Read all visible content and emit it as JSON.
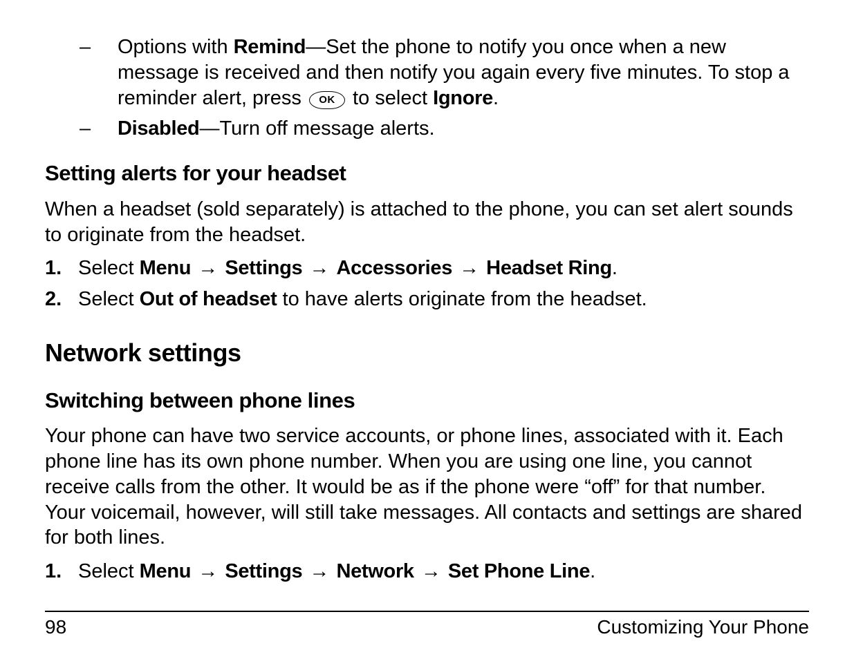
{
  "bullets": {
    "remind": {
      "label": "Remind",
      "prefix": "Options with ",
      "divider": "—",
      "text1": "Set the phone to notify you once when a new message is received and then notify you again every five minutes. To stop a reminder alert, press ",
      "ok": "OK",
      "text2": " to select ",
      "ignore": "Ignore",
      "period": "."
    },
    "disabled": {
      "label": "Disabled",
      "divider": "—",
      "text": "Turn off message alerts."
    }
  },
  "headset": {
    "heading": "Setting alerts for your headset",
    "intro": "When a headset (sold separately) is attached to the phone, you can set alert sounds to originate from the headset.",
    "steps": [
      {
        "n": "1.",
        "prefix": "Select ",
        "path": [
          "Menu",
          "Settings",
          "Accessories",
          "Headset Ring"
        ],
        "suffix": "."
      },
      {
        "n": "2.",
        "prefix": "Select ",
        "bold": "Out of headset",
        "suffix": " to have alerts originate from the headset."
      }
    ]
  },
  "network": {
    "heading": "Network settings",
    "switching": {
      "heading": "Switching between phone lines",
      "intro": "Your phone can have two service accounts, or phone lines, associated with it. Each phone line has its own phone number. When you are using one line, you cannot receive calls from the other. It would be as if the phone were “off” for that number. Your voicemail, however, will still take messages. All contacts and settings are shared for both lines.",
      "step": {
        "n": "1.",
        "prefix": "Select ",
        "path": [
          "Menu",
          "Settings",
          "Network",
          "Set Phone Line"
        ],
        "suffix": "."
      }
    }
  },
  "footer": {
    "page": "98",
    "title": "Customizing Your Phone"
  },
  "arrow": "→"
}
